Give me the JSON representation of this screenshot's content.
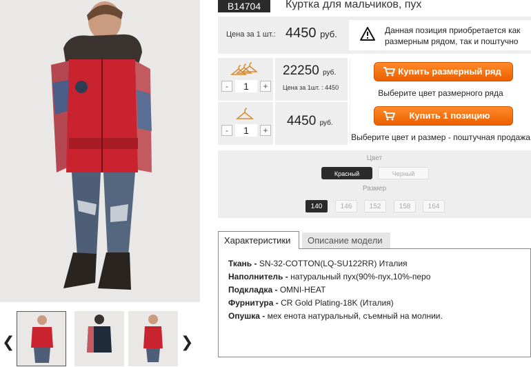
{
  "product": {
    "sku": "B14704",
    "title": "Куртка для мальчиков, пух"
  },
  "price": {
    "label": "Цена за 1 шт.:",
    "value": "4450",
    "currency": "руб."
  },
  "notice": {
    "text": "Данная позиция приобретается как размерным рядом, так и поштучно"
  },
  "buy_set": {
    "qty": "1",
    "total": "22250",
    "currency": "руб.",
    "unit_note": "Цена за 1шт. : 4450",
    "button_label": "Купить размерный ряд",
    "hint": "Выберите цвет размерного ряда"
  },
  "buy_single": {
    "qty": "1",
    "total": "4450",
    "currency": "руб.",
    "button_label": "Купить 1 позицию",
    "hint": "Выберите цвет и размер - поштучная продажа"
  },
  "stepper": {
    "minus": "-",
    "plus": "+"
  },
  "filters": {
    "color_label": "Цвет",
    "colors": [
      "Красный",
      "Черный"
    ],
    "selected_color": "Красный",
    "size_label": "Размер",
    "sizes": [
      "140",
      "146",
      "152",
      "158",
      "164"
    ],
    "selected_size": "140"
  },
  "tabs": {
    "characteristics": "Характеристики",
    "description": "Описание модели"
  },
  "specs": [
    {
      "key": "Ткань -",
      "value": "SN-32-COTTON(LQ-SU122RR) Италия"
    },
    {
      "key": "Наполнитель -",
      "value": "натуральный пух(90%-пух,10%-перо"
    },
    {
      "key": "Подкладка -",
      "value": "OMNI-HEAT"
    },
    {
      "key": "Фурнитура -",
      "value": "CR Gold Plating-18K (Италия)"
    },
    {
      "key": "Опушка -",
      "value": "мех енота натуральный, съемный на молнии."
    }
  ],
  "colors": {
    "accent": "#f26a0c",
    "dark": "#2b2b2b",
    "panel": "#eeeeee"
  },
  "icons": {
    "prev": "chevron-left-icon",
    "next": "chevron-right-icon",
    "warning": "warning-icon",
    "cart": "cart-icon",
    "hanger": "hanger-icon"
  },
  "gallery_arrows": {
    "prev": "❮",
    "next": "❯"
  }
}
